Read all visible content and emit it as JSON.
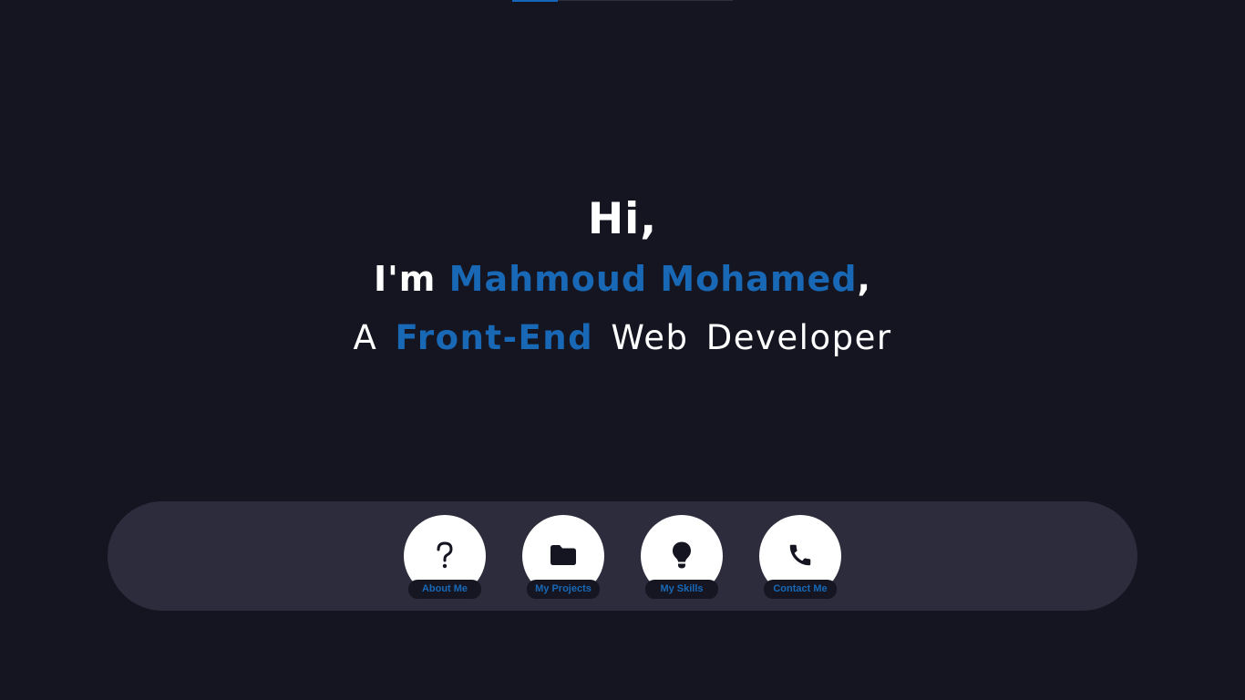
{
  "hero": {
    "greeting": "Hi,",
    "intro_prefix": "I'm ",
    "name": "Mahmoud Mohamed",
    "intro_suffix": ",",
    "role_prefix": "A ",
    "role_highlight": "Front-End",
    "role_suffix": " Web Developer"
  },
  "dock": {
    "items": [
      {
        "label": "About Me",
        "icon": "question-icon"
      },
      {
        "label": "My Projects",
        "icon": "folder-icon"
      },
      {
        "label": "My Skills",
        "icon": "lightbulb-icon"
      },
      {
        "label": "Contact Me",
        "icon": "phone-icon"
      }
    ]
  },
  "colors": {
    "background": "#141521",
    "accent": "#1868b6",
    "dock": "#2d2c3d",
    "text": "#ffffff"
  }
}
